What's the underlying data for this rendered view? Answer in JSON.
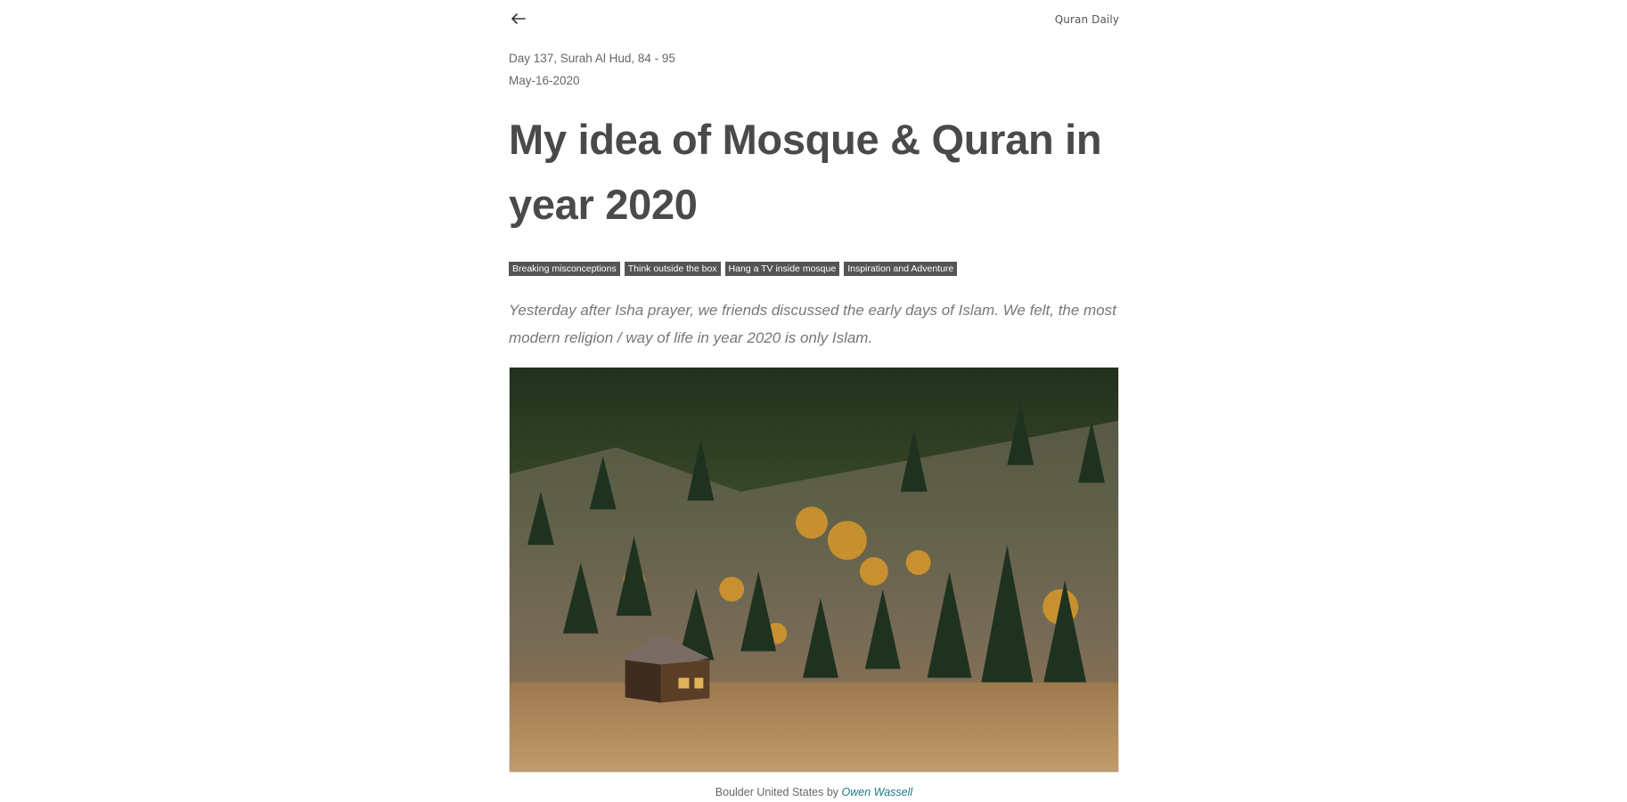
{
  "header": {
    "back_icon": "arrow-left-icon",
    "brand": "Quran Daily"
  },
  "post": {
    "day_line": "Day 137, Surah Al Hud, 84 - 95",
    "date": "May-16-2020",
    "title": "My idea of Mosque & Quran in year 2020",
    "tags": [
      "Breaking misconceptions",
      "Think outside the box",
      "Hang a TV inside mosque",
      "Inspiration and Adventure"
    ],
    "intro": "Yesterday after Isha prayer, we friends discussed the early days of Islam. We felt, the most modern religion / way of life in year 2020 is only Islam."
  },
  "photo": {
    "caption_prefix": "Boulder United States by ",
    "author": "Owen Wassell"
  },
  "colors": {
    "tag_bg": "#555555",
    "link": "#1a7a86"
  }
}
